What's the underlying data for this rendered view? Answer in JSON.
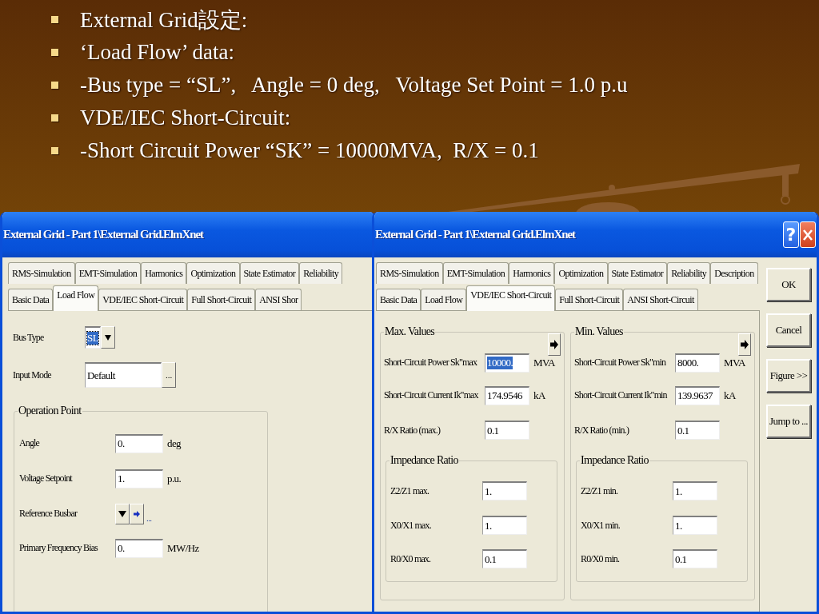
{
  "bullets": [
    "External Grid設定:",
    "‘Load Flow’ data:",
    "-Bus type = “SL”,   Angle = 0 deg,   Voltage Set Point = 1.0 p.u",
    "VDE/IEC Short-Circuit:",
    "-Short Circuit Power “SK” = 10000MVA,  R/X = 0.1"
  ],
  "windows": [
    {
      "title": "External Grid - Part 1\\External Grid.ElmXnet",
      "tab_rows": [
        [
          {
            "label": "RMS-Simulation",
            "selected": false
          },
          {
            "label": "EMT-Simulation",
            "selected": false
          },
          {
            "label": "Harmonics",
            "selected": false
          },
          {
            "label": "Optimization",
            "selected": false
          },
          {
            "label": "State Estimator",
            "selected": false
          },
          {
            "label": "Reliability",
            "selected": false
          }
        ],
        [
          {
            "label": "Basic Data",
            "selected": false
          },
          {
            "label": "Load Flow",
            "selected": true
          },
          {
            "label": "VDE/IEC Short-Circuit",
            "selected": false
          },
          {
            "label": "Full Short-Circuit",
            "selected": false
          },
          {
            "label": "ANSI Shor",
            "selected": false
          }
        ]
      ],
      "content": {
        "kind": "load_flow",
        "fields": [
          {
            "kind": "dropdown",
            "label": "Bus Type",
            "value": "SL",
            "highlighted": true
          },
          {
            "kind": "browse",
            "label": "Input Mode",
            "value": "Default",
            "button": "..."
          }
        ],
        "groups": [
          {
            "title": "Operation Point",
            "rows": [
              {
                "kind": "number",
                "label": "Angle",
                "value": "0.",
                "unit": "deg",
                "highlighted": false
              },
              {
                "kind": "number",
                "label": "Voltage Setpoint",
                "value": "1.",
                "unit": "p.u.",
                "highlighted": false
              },
              {
                "kind": "reference",
                "label": "Reference Busbar",
                "link": "..."
              },
              {
                "kind": "number",
                "label": "Primary Frequency Bias",
                "value": "0.",
                "unit": "MW/Hz",
                "highlighted": false
              }
            ]
          }
        ]
      }
    },
    {
      "title": "External Grid - Part 1\\External Grid.ElmXnet",
      "controls": [
        {
          "kind": "help",
          "label": "?"
        },
        {
          "kind": "close"
        }
      ],
      "tab_rows": [
        [
          {
            "label": "RMS-Simulation",
            "selected": false
          },
          {
            "label": "EMT-Simulation",
            "selected": false
          },
          {
            "label": "Harmonics",
            "selected": false
          },
          {
            "label": "Optimization",
            "selected": false
          },
          {
            "label": "State Estimator",
            "selected": false
          },
          {
            "label": "Reliability",
            "selected": false
          },
          {
            "label": "Description",
            "selected": false
          }
        ],
        [
          {
            "label": "Basic Data",
            "selected": false
          },
          {
            "label": "Load Flow",
            "selected": false
          },
          {
            "label": "VDE/IEC Short-Circuit",
            "selected": true
          },
          {
            "label": "Full Short-Circuit",
            "selected": false
          },
          {
            "label": "ANSI Short-Circuit",
            "selected": false
          }
        ]
      ],
      "content": {
        "kind": "short_circuit",
        "groups": [
          {
            "title": "Max. Values",
            "rows": [
              {
                "kind": "number",
                "label": "Short-Circuit Power Sk\"max",
                "value": "10000.",
                "unit": "MVA",
                "highlighted": true
              },
              {
                "kind": "number",
                "label": "Short-Circuit Current Ik\"max",
                "value": "174.9546",
                "unit": "kA",
                "highlighted": false
              },
              {
                "kind": "number",
                "label": "R/X Ratio (max.)",
                "value": "0.1",
                "highlighted": false
              }
            ],
            "subgroup": {
              "title": "Impedance Ratio",
              "rows": [
                {
                  "kind": "number",
                  "label": "Z2/Z1 max.",
                  "value": "1.",
                  "highlighted": false
                },
                {
                  "kind": "number",
                  "label": "X0/X1 max.",
                  "value": "1.",
                  "highlighted": false
                },
                {
                  "kind": "number",
                  "label": "R0/X0 max.",
                  "value": "0.1",
                  "highlighted": false
                }
              ]
            }
          },
          {
            "title": "Min. Values",
            "rows": [
              {
                "kind": "number",
                "label": "Short-Circuit Power Sk\"min",
                "value": "8000.",
                "unit": "MVA",
                "highlighted": false
              },
              {
                "kind": "number",
                "label": "Short-Circuit Current Ik\"min",
                "value": "139.9637",
                "unit": "kA",
                "highlighted": false
              },
              {
                "kind": "number",
                "label": "R/X Ratio (min.)",
                "value": "0.1",
                "highlighted": false
              }
            ],
            "subgroup": {
              "title": "Impedance Ratio",
              "rows": [
                {
                  "kind": "number",
                  "label": "Z2/Z1 min.",
                  "value": "1.",
                  "highlighted": false
                },
                {
                  "kind": "number",
                  "label": "X0/X1 min.",
                  "value": "1.",
                  "highlighted": false
                },
                {
                  "kind": "number",
                  "label": "R0/X0 min.",
                  "value": "0.1",
                  "highlighted": false
                }
              ]
            }
          }
        ]
      },
      "buttons": [
        "OK",
        "Cancel",
        "Figure >>",
        "Jump to ..."
      ]
    }
  ]
}
